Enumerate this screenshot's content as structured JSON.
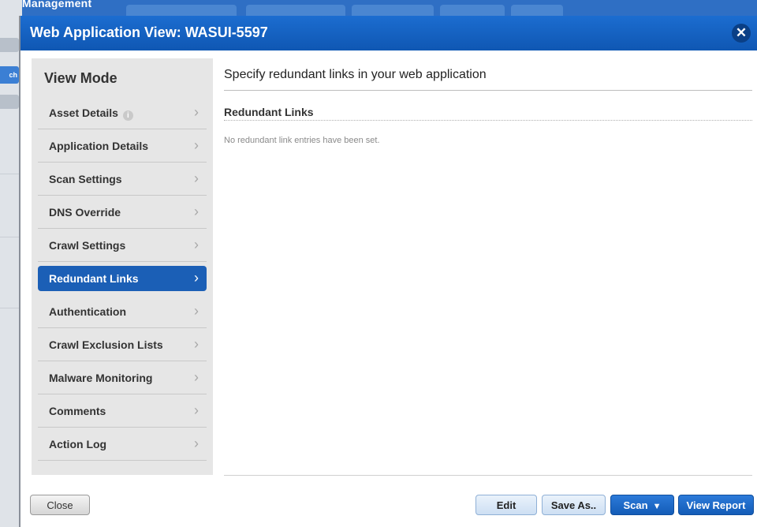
{
  "background": {
    "app_title": "on Management",
    "side_button_label": "ch"
  },
  "modal": {
    "title": "Web Application View: WASUI-5597",
    "close_icon": "close-x-icon"
  },
  "sidebar": {
    "heading": "View Mode",
    "items": [
      {
        "label": "Asset Details",
        "info_icon": "info-icon",
        "active": false
      },
      {
        "label": "Application Details",
        "active": false
      },
      {
        "label": "Scan Settings",
        "active": false
      },
      {
        "label": "DNS Override",
        "active": false
      },
      {
        "label": "Crawl Settings",
        "active": false
      },
      {
        "label": "Redundant Links",
        "active": true
      },
      {
        "label": "Authentication",
        "active": false
      },
      {
        "label": "Crawl Exclusion Lists",
        "active": false
      },
      {
        "label": "Malware Monitoring",
        "active": false
      },
      {
        "label": "Comments",
        "active": false
      },
      {
        "label": "Action Log",
        "active": false
      }
    ],
    "chevron": "›"
  },
  "content": {
    "heading": "Specify redundant links in your web application",
    "section_title": "Redundant Links",
    "empty_message": "No redundant link entries have been set."
  },
  "footer": {
    "close_label": "Close",
    "edit_label": "Edit",
    "save_as_label": "Save As..",
    "scan_label": "Scan",
    "view_report_label": "View Report"
  },
  "colors": {
    "header_blue": "#1c6dd0",
    "active_nav": "#1b5fb6",
    "sidebar_bg": "#e6e6e6"
  }
}
